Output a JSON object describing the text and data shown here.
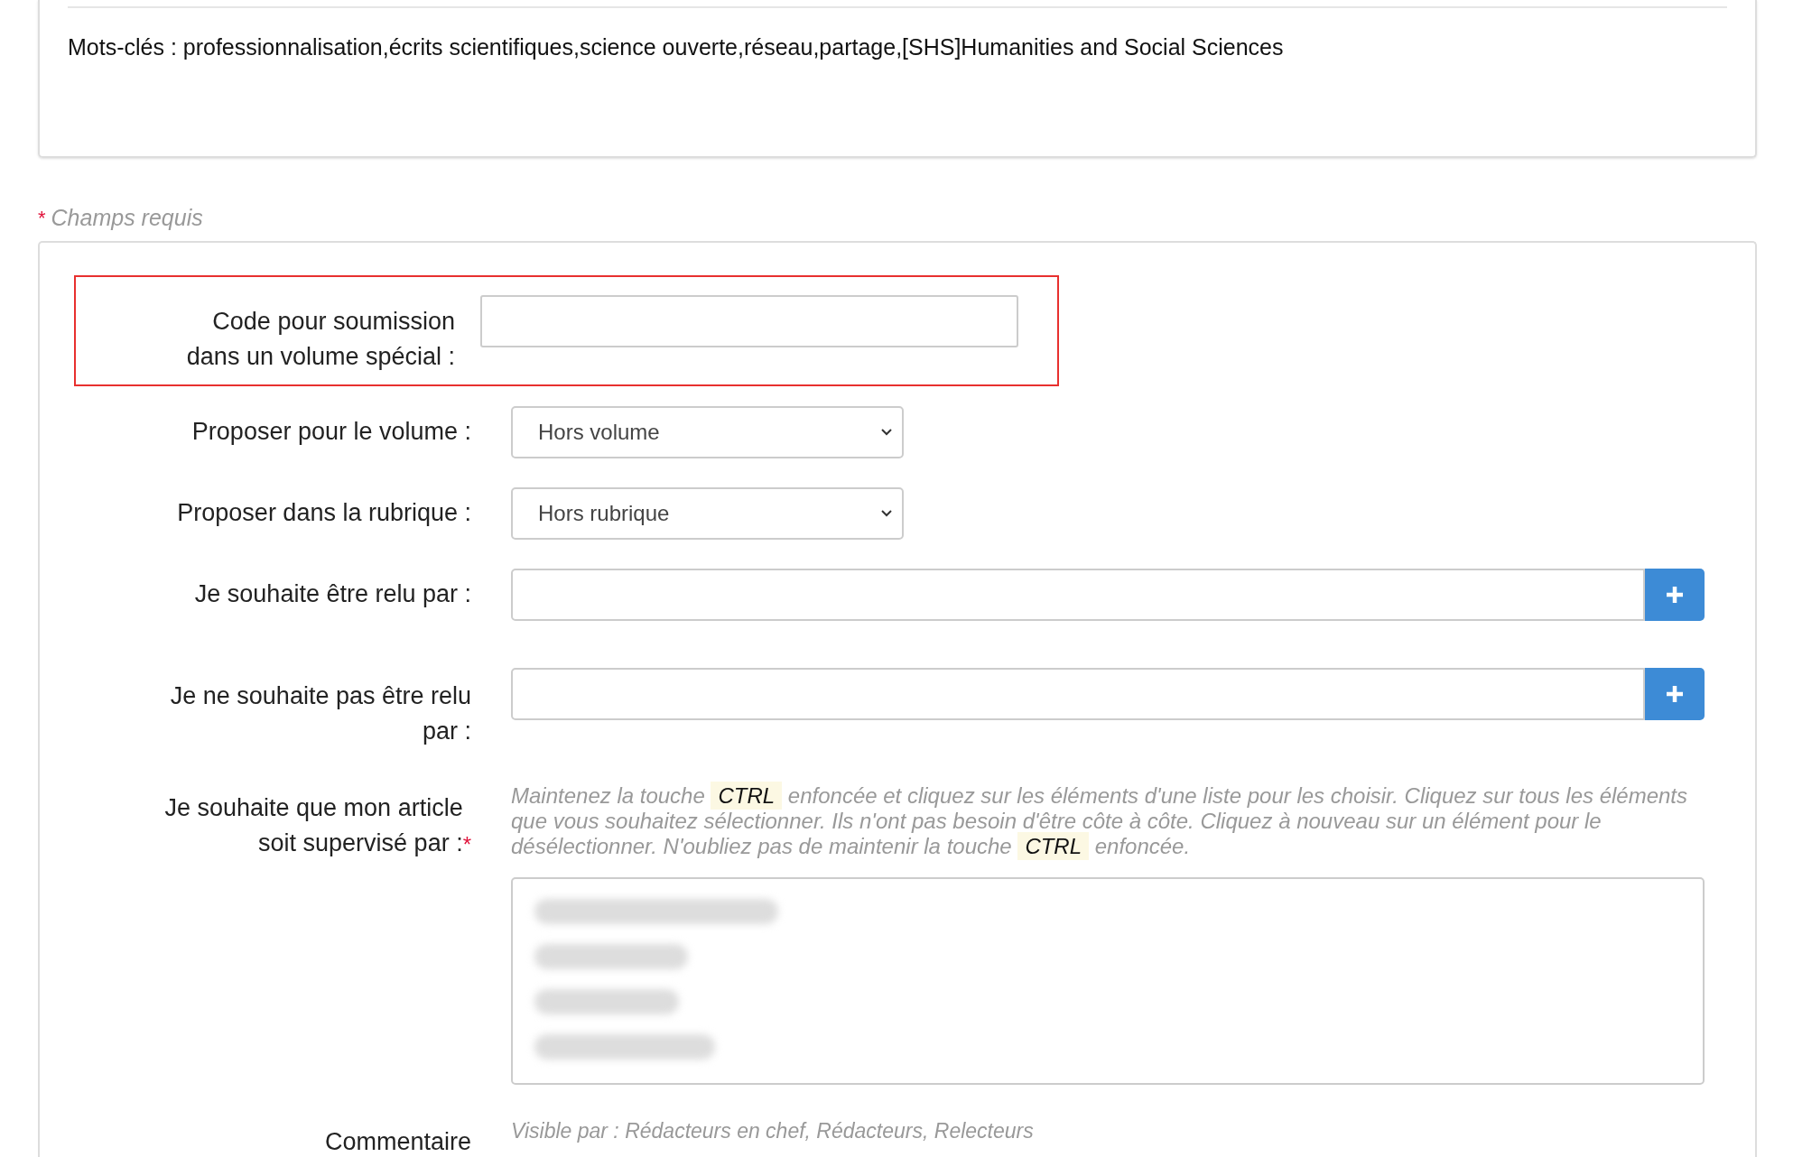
{
  "summary_card": {
    "keywords": "Mots-clés : professionnalisation,écrits scientifiques,science ouverte,réseau,partage,[SHS]Humanities and Social Sciences"
  },
  "required_note": {
    "marker": "*",
    "text": "Champs requis"
  },
  "form": {
    "special_code": {
      "label": "Code pour soumission dans un volume spécial :",
      "highlighted": true
    },
    "volume": {
      "label": "Proposer pour le volume :",
      "value": "Hors volume"
    },
    "section": {
      "label": "Proposer dans la rubrique :",
      "value": "Hors rubrique"
    },
    "reviewers_wanted": {
      "label": "Je souhaite être relu par :"
    },
    "reviewers_unwanted": {
      "label": "Je ne souhaite pas être relu par :"
    },
    "supervisor": {
      "label": "Je souhaite que mon article soit supervisé par :",
      "required": true,
      "hint": [
        "Maintenez la touche ",
        "CTRL",
        " enfoncée et cliquez sur les éléments d'une liste pour les choisir. Cliquez sur tous les éléments que vous souhaitez sélectionner. Ils n'ont pas besoin d'être côte à côte. Cliquez à nouveau sur un élément pour le désélectionner. N'oubliez pas de maintenir la touche ",
        "CTRL",
        " enfoncée."
      ],
      "options": [
        {
          "kind": "redacted"
        },
        {
          "kind": "redacted"
        },
        {
          "kind": "redacted"
        },
        {
          "kind": "redacted"
        }
      ]
    },
    "comment": {
      "label": "Commentaire",
      "hint": "Visible par : Rédacteurs en chef, Rédacteurs, Relecteurs"
    }
  }
}
